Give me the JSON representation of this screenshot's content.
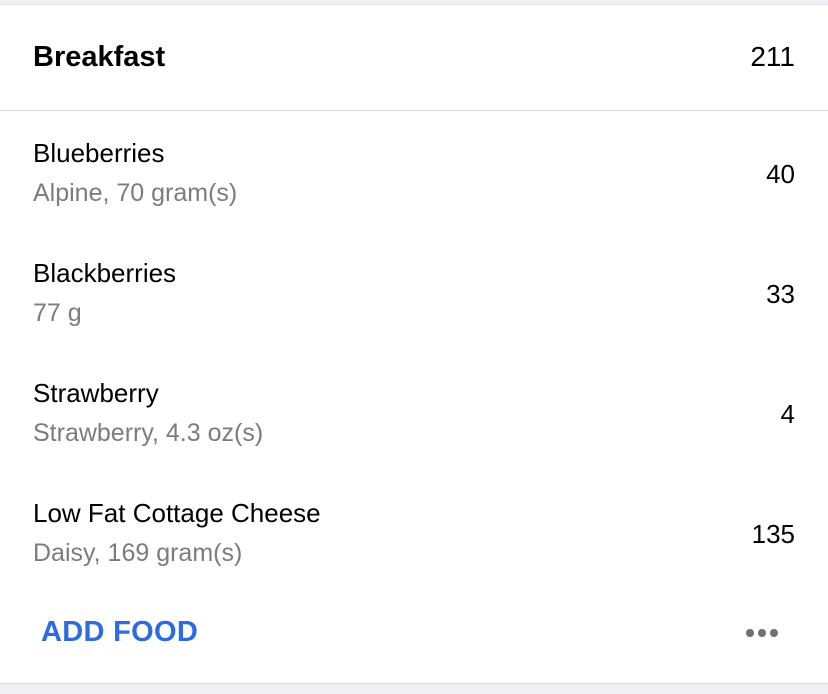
{
  "meal": {
    "title": "Breakfast",
    "total": "211"
  },
  "entries": [
    {
      "name": "Blueberries",
      "detail": "Alpine, 70 gram(s)",
      "calories": "40"
    },
    {
      "name": "Blackberries",
      "detail": "77 g",
      "calories": "33"
    },
    {
      "name": "Strawberry",
      "detail": "Strawberry, 4.3 oz(s)",
      "calories": "4"
    },
    {
      "name": "Low Fat Cottage Cheese",
      "detail": "Daisy, 169 gram(s)",
      "calories": "135"
    }
  ],
  "actions": {
    "add_food_label": "ADD FOOD",
    "more_icon": "more-horizontal-icon"
  },
  "colors": {
    "accent": "#2d6be0",
    "secondary_text": "#7b7b80",
    "background": "#efeff4"
  }
}
